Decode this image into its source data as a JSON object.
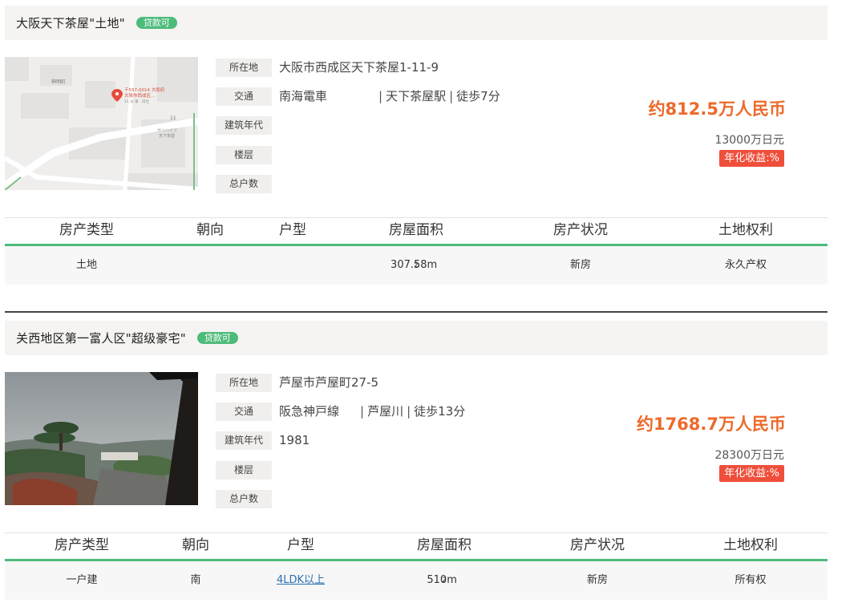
{
  "listings": [
    {
      "title": "大阪天下茶屋\"土地\"",
      "loan_badge": "贷款可",
      "map": {
        "pin_line1": "〒557-0014 大阪府",
        "pin_line2": "大阪市西成区…",
        "pin_line3": "21 分 第 · 日仕",
        "block_label_1": "神明町",
        "block_label_2": "11",
        "block_label_3": "サンハイツ",
        "block_label_4": "天下茶屋"
      },
      "specs": {
        "address_label": "所在地",
        "address_value": "大阪市西成区天下茶屋1-11-9",
        "transit_label": "交通",
        "transit_line": "南海電車",
        "transit_station": "天下茶屋駅",
        "transit_walk": "徒歩7分",
        "built_label": "建筑年代",
        "built_value": "",
        "floor_label": "楼层",
        "floor_value": "",
        "units_label": "总户数",
        "units_value": ""
      },
      "price_cny": "约812.5万人民币",
      "price_jpy": "13000万日元",
      "yield_text": "年化收益:%",
      "table": {
        "headers": [
          "房产类型",
          "朝向",
          "户型",
          "房屋面积",
          "房产状况",
          "土地权利"
        ],
        "type": "土地",
        "orientation": "",
        "layout": "",
        "area": "307.58m",
        "area_sup": "2",
        "status": "新房",
        "land_right": "永久产权"
      }
    },
    {
      "title": "关西地区第一富人区\"超级豪宅\"",
      "loan_badge": "贷款可",
      "specs": {
        "address_label": "所在地",
        "address_value": "芦屋市芦屋町27-5",
        "transit_label": "交通",
        "transit_line": "阪急神戸線",
        "transit_station": "芦屋川",
        "transit_walk": "徒歩13分",
        "built_label": "建筑年代",
        "built_value": "1981",
        "floor_label": "楼层",
        "floor_value": "",
        "units_label": "总户数",
        "units_value": ""
      },
      "price_cny": "约1768.7万人民币",
      "price_jpy": "28300万日元",
      "yield_text": "年化收益:%",
      "table": {
        "headers": [
          "房产类型",
          "朝向",
          "户型",
          "房屋面积",
          "房产状况",
          "土地权利"
        ],
        "type": "一户建",
        "orientation": "南",
        "layout": "4LDK以上",
        "area": "510m",
        "area_sup": "2",
        "status": "新房",
        "land_right": "所有权"
      }
    }
  ],
  "colors": {
    "accent_green": "#4dbb7a",
    "price_orange": "#ec6a2a",
    "yield_red": "#ef4f3a",
    "header_bg": "#f5f4f2"
  }
}
